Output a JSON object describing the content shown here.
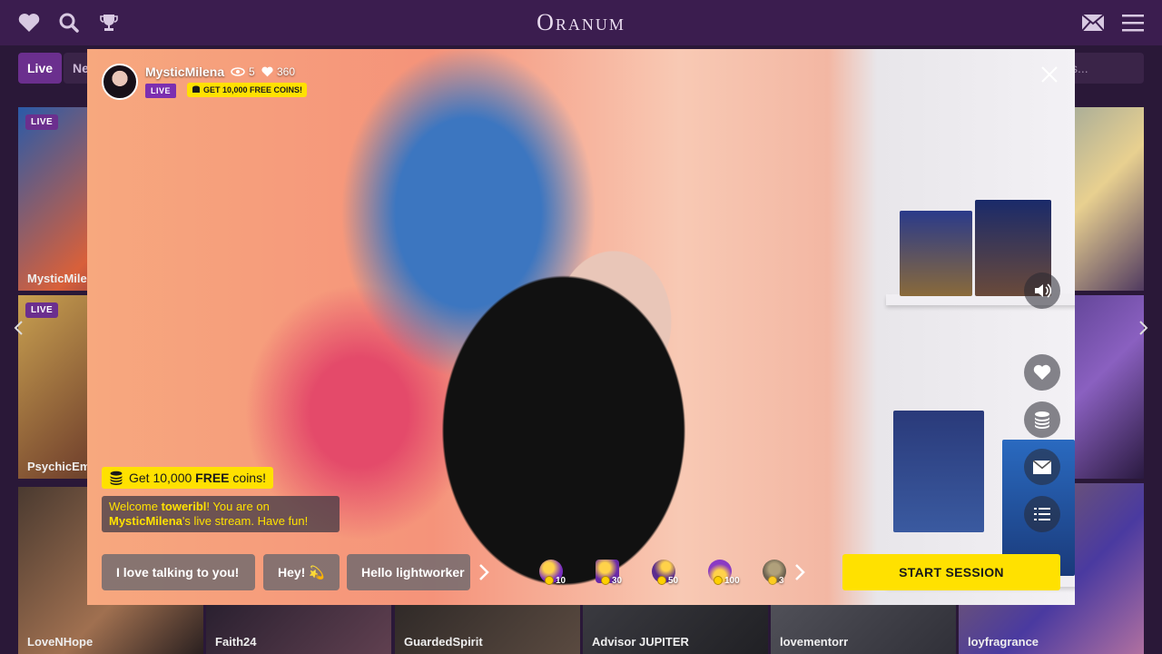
{
  "brand": "Oranum",
  "filters": {
    "live": "Live",
    "new": "Ne",
    "search_placeholder": "s..."
  },
  "tiles": [
    {
      "name": "MysticMile",
      "live": "LIVE"
    },
    {
      "name": "PsychicEm",
      "live": "LIVE"
    },
    {
      "name": "LoveNHope"
    },
    {
      "name": "Faith24"
    },
    {
      "name": "GuardedSpirit"
    },
    {
      "name": "Advisor JUPITER"
    },
    {
      "name": "lovementorr"
    },
    {
      "name": "loyfragrance"
    }
  ],
  "modal": {
    "host_name": "MysticMilena",
    "viewers": "5",
    "likes": "360",
    "live_label": "LIVE",
    "coins_promo": "GET 10,000 FREE COINS!",
    "free_coins": {
      "prefix": "Get 10,000 ",
      "bold": "FREE",
      "suffix": " coins!"
    },
    "welcome": {
      "p1": "Welcome ",
      "user": "toweribl",
      "p2": "! You are on ",
      "host": "MysticMilena",
      "p3": "'s live stream. Have fun!"
    },
    "quick_messages": [
      "I love talking to you!",
      "Hey! 💫",
      "Hello lightworker"
    ],
    "gifts": [
      {
        "price": "10",
        "color": "#7a2fc0"
      },
      {
        "price": "30",
        "color": "#6a2aa8"
      },
      {
        "price": "50",
        "color": "#5b2c8f"
      },
      {
        "price": "100",
        "color": "#8a3ac4"
      },
      {
        "price": "3",
        "color": "#4a4a3a"
      }
    ],
    "start_session": "START SESSION"
  }
}
